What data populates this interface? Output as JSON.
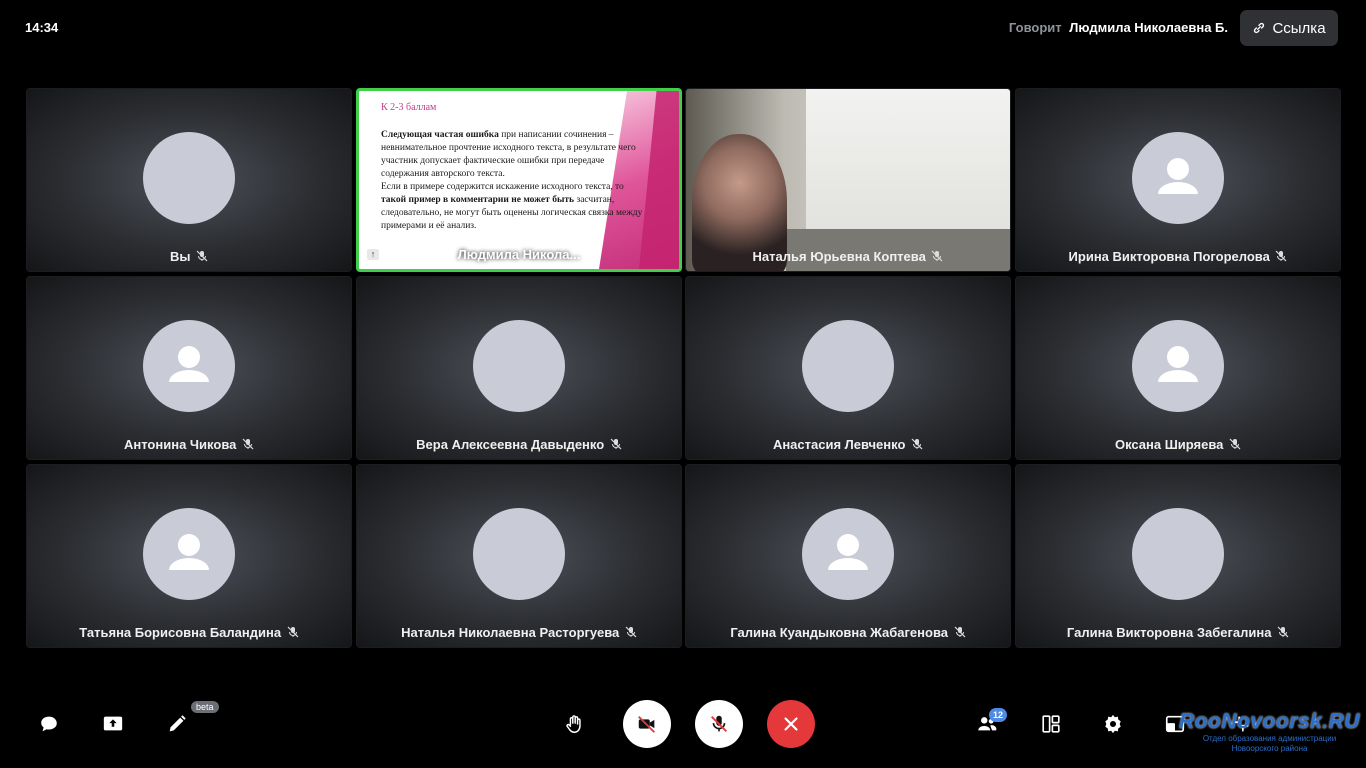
{
  "topbar": {
    "clock": "14:34",
    "speaking_label": "Говорит",
    "speaking_name": "Людмила Николаевна Б.",
    "link_label": "Ссылка"
  },
  "tiles": [
    {
      "name": "Вы",
      "type": "photo",
      "photo": "gazebo",
      "muted": true
    },
    {
      "name": "Людмила Никола...",
      "type": "screen-share",
      "muted": false,
      "active": true
    },
    {
      "name": "Наталья Юрьевна Коптева",
      "type": "video",
      "muted": true
    },
    {
      "name": "Ирина Викторовна Погорелова",
      "type": "placeholder",
      "muted": true
    },
    {
      "name": "Антонина Чикова",
      "type": "placeholder",
      "muted": true
    },
    {
      "name": "Вера Алексеевна Давыденко",
      "type": "photo",
      "photo": "vera",
      "muted": true
    },
    {
      "name": "Анастасия Левченко",
      "type": "photo",
      "photo": "anast",
      "muted": true
    },
    {
      "name": "Оксана Ширяева",
      "type": "placeholder",
      "muted": true
    },
    {
      "name": "Татьяна Борисовна Баландина",
      "type": "placeholder",
      "muted": true
    },
    {
      "name": "Наталья Николаевна Расторгуева",
      "type": "photo",
      "photo": "rast",
      "muted": true
    },
    {
      "name": "Галина Куандыковна Жабагенова",
      "type": "placeholder",
      "muted": true
    },
    {
      "name": "Галина Викторовна Забегалина",
      "type": "photo",
      "photo": "zab",
      "muted": true
    }
  ],
  "slide": {
    "title": "К 2-3 баллам",
    "line1_bold": "Следующая частая ошибка",
    "line1_rest": " при написании сочинения – невнимательное прочтение исходного текста, в результате чего участник допускает фактические ошибки при передаче содержания авторского текста.",
    "line2_a": "Если в примере содержится искажение исходного текста, то ",
    "line2_bold": "такой пример в комментарии не может быть",
    "line2_b": " засчитан, следовательно, не могут быть оценены логическая связка между примерами и её анализ."
  },
  "toolbar": {
    "beta_label": "beta",
    "participants_count": "12",
    "watermark_title": "RooNovoorsk.RU",
    "watermark_sub1": "Отдел образования администрации",
    "watermark_sub2": "Новоорского района"
  },
  "colors": {
    "active_border": "#3fcf4b",
    "hangup": "#e4383b",
    "badge": "#4e8be6",
    "link_button": "#2f3135"
  }
}
